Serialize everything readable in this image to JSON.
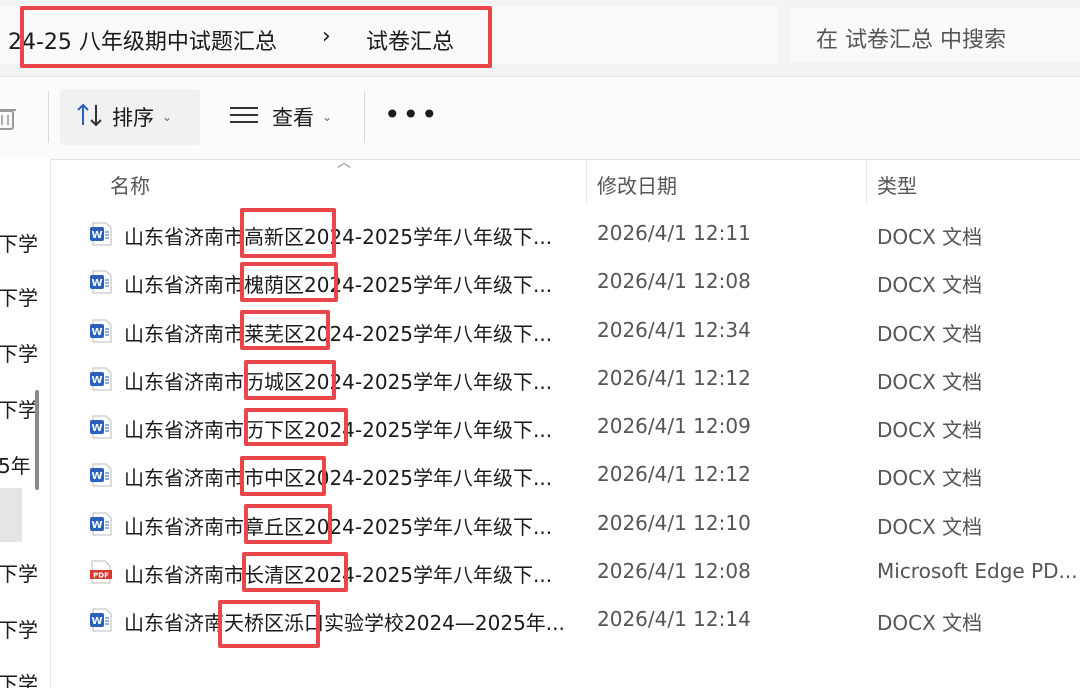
{
  "breadcrumb": {
    "parent": "24-25 八年级期中试题汇总",
    "separator": "›",
    "current": "试卷汇总"
  },
  "search": {
    "placeholder": "在 试卷汇总 中搜索"
  },
  "toolbar": {
    "sort_label": "排序",
    "view_label": "查看",
    "more_label": "•••"
  },
  "nav": {
    "items": [
      "下学",
      "下学",
      "下学",
      "下学",
      "5年",
      "下学",
      "下学",
      "下学"
    ]
  },
  "columns": {
    "name": "名称",
    "date": "修改日期",
    "type": "类型"
  },
  "files": [
    {
      "name": "山东省济南市高新区2024-2025学年八年级下...",
      "date": "2026/4/1 12:11",
      "type": "DOCX 文档",
      "icon": "word-icon"
    },
    {
      "name": "山东省济南市槐荫区2024-2025学年八年级下...",
      "date": "2026/4/1 12:08",
      "type": "DOCX 文档",
      "icon": "word-icon"
    },
    {
      "name": "山东省济南市莱芜区2024-2025学年八年级下...",
      "date": "2026/4/1 12:34",
      "type": "DOCX 文档",
      "icon": "word-icon"
    },
    {
      "name": "山东省济南市历城区2024-2025学年八年级下...",
      "date": "2026/4/1 12:12",
      "type": "DOCX 文档",
      "icon": "word-icon"
    },
    {
      "name": "山东省济南市历下区2024-2025学年八年级下...",
      "date": "2026/4/1 12:09",
      "type": "DOCX 文档",
      "icon": "word-icon"
    },
    {
      "name": "山东省济南市市中区2024-2025学年八年级下...",
      "date": "2026/4/1 12:12",
      "type": "DOCX 文档",
      "icon": "word-icon"
    },
    {
      "name": "山东省济南市章丘区2024-2025学年八年级下...",
      "date": "2026/4/1 12:10",
      "type": "DOCX 文档",
      "icon": "word-icon"
    },
    {
      "name": "山东省济南市长清区2024-2025学年八年级下...",
      "date": "2026/4/1 12:08",
      "type": "Microsoft Edge PD...",
      "icon": "pdf-icon"
    },
    {
      "name": "山东省济南天桥区泺口实验学校2024—2025年...",
      "date": "2026/4/1 12:14",
      "type": "DOCX 文档",
      "icon": "word-icon"
    }
  ],
  "colors": {
    "annotation": "#e8464b",
    "word_blue": "#2b5fbd",
    "pdf_red": "#d63b2f"
  }
}
